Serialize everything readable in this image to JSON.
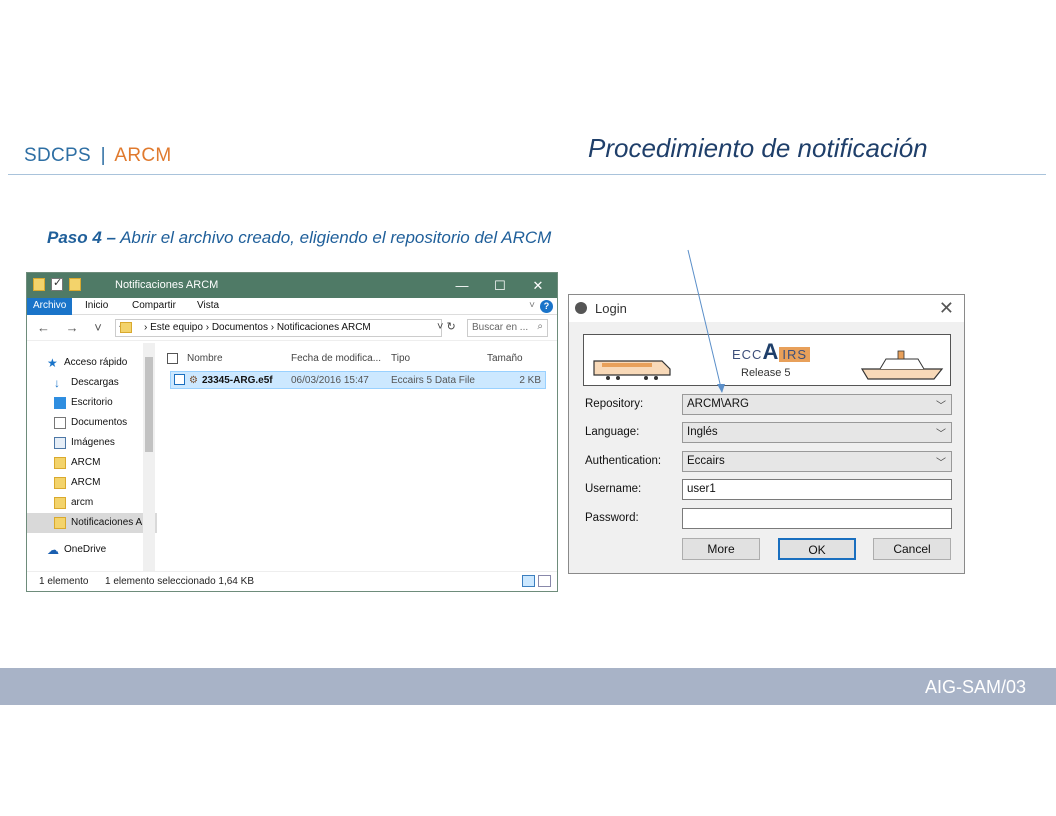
{
  "header": {
    "brand_left": "SDCPS",
    "brand_sep": "|",
    "brand_right": "ARCM",
    "title": "Procedimiento de notificación"
  },
  "step": {
    "label": "Paso 4 –",
    "text": "Abrir el archivo creado, eligiendo el repositorio del ARCM"
  },
  "footer": {
    "code": "AIG-SAM/03"
  },
  "explorer": {
    "title": "Notificaciones ARCM",
    "ribbon": {
      "file": "Archivo",
      "home": "Inicio",
      "share": "Compartir",
      "view": "Vista"
    },
    "window_buttons": {
      "minimize": "—",
      "maximize": "☐",
      "close": "✕"
    },
    "nav_arrows": "← → ˅ ↑",
    "path": "›  Este equipo  ›  Documentos  ›  Notificaciones ARCM",
    "search_placeholder": "Buscar en ...",
    "nav_items": [
      {
        "label": "Acceso rápido",
        "icon": "star-icon"
      },
      {
        "label": "Descargas",
        "icon": "download-icon"
      },
      {
        "label": "Escritorio",
        "icon": "desktop-icon"
      },
      {
        "label": "Documentos",
        "icon": "document-icon"
      },
      {
        "label": "Imágenes",
        "icon": "image-icon"
      },
      {
        "label": "ARCM",
        "icon": "folder-icon"
      },
      {
        "label": "ARCM",
        "icon": "folder-icon"
      },
      {
        "label": "arcm",
        "icon": "folder-icon"
      },
      {
        "label": "Notificaciones A",
        "icon": "folder-icon"
      },
      {
        "label": "OneDrive",
        "icon": "cloud-icon"
      }
    ],
    "columns": {
      "name": "Nombre",
      "date": "Fecha de modifica...",
      "type": "Tipo",
      "size": "Tamaño"
    },
    "file": {
      "name": "23345-ARG.e5f",
      "date": "06/03/2016 15:47",
      "type": "Eccairs 5 Data File",
      "size": "2 KB"
    },
    "status": {
      "count": "1 elemento",
      "selected": "1 elemento seleccionado  1,64 KB"
    }
  },
  "login": {
    "title": "Login",
    "banner": {
      "logo_a": "ECC",
      "logo_b": "A",
      "logo_c": "IRS",
      "release": "Release 5"
    },
    "fields": {
      "repository_label": "Repository:",
      "repository_value": "ARCM\\ARG",
      "language_label": "Language:",
      "language_value": "Inglés",
      "authentication_label": "Authentication:",
      "authentication_value": "Eccairs",
      "username_label": "Username:",
      "username_value": "user1",
      "password_label": "Password:",
      "password_value": ""
    },
    "buttons": {
      "more": "More",
      "ok": "OK",
      "cancel": "Cancel"
    }
  },
  "colors": {
    "brand_blue": "#2e6fa4",
    "brand_orange": "#e07a2e",
    "footer": "#a8b3c7",
    "explorer_title": "#4f7a66"
  }
}
